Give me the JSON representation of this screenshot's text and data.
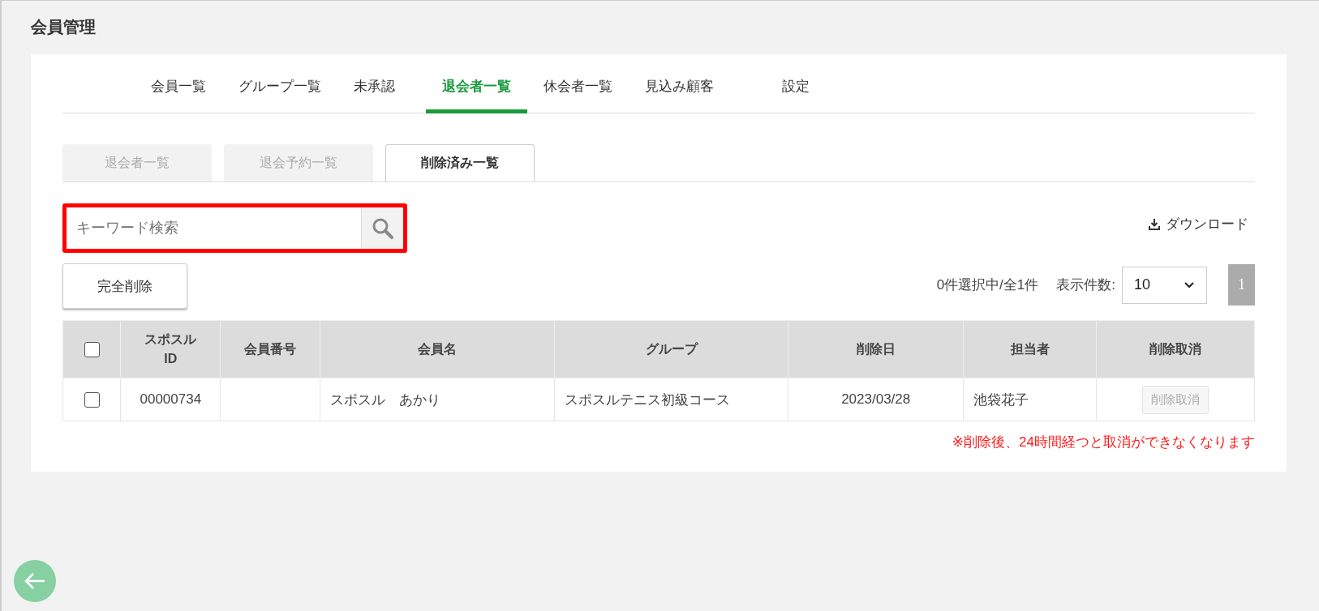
{
  "page_title": "会員管理",
  "tabs": [
    {
      "label": "会員一覧",
      "selected": false
    },
    {
      "label": "グループ一覧",
      "selected": false
    },
    {
      "label": "未承認",
      "selected": false
    },
    {
      "label": "退会者一覧",
      "selected": true
    },
    {
      "label": "休会者一覧",
      "selected": false
    },
    {
      "label": "見込み顧客",
      "selected": false
    },
    {
      "label": "設定",
      "selected": false
    }
  ],
  "sub_tabs": [
    {
      "label": "退会者一覧",
      "selected": false
    },
    {
      "label": "退会予約一覧",
      "selected": false
    },
    {
      "label": "削除済み一覧",
      "selected": true
    }
  ],
  "search": {
    "placeholder": "キーワード検索",
    "highlighted": true
  },
  "download": "ダウンロード",
  "delete_button": "完全削除",
  "selection_count": "0件選択中/全1件",
  "per_page_label": "表示件数:",
  "per_page_value": "10",
  "pages": [
    {
      "label": "1",
      "selected": true
    }
  ],
  "table": {
    "select_all_checked": false,
    "columns": [
      "スポスル\nID",
      "会員番号",
      "会員名",
      "グループ",
      "削除日",
      "担当者",
      "削除取消"
    ],
    "rows": [
      {
        "checked": false,
        "cells": [
          "00000734",
          "",
          "スポスル　あかり",
          "スポスルテニス初級コース",
          "2023/03/28",
          "池袋花子"
        ],
        "action": {
          "label": "削除取消",
          "disabled": true
        }
      }
    ]
  },
  "notice": "※削除後、24時間経つと取消ができなくなります"
}
